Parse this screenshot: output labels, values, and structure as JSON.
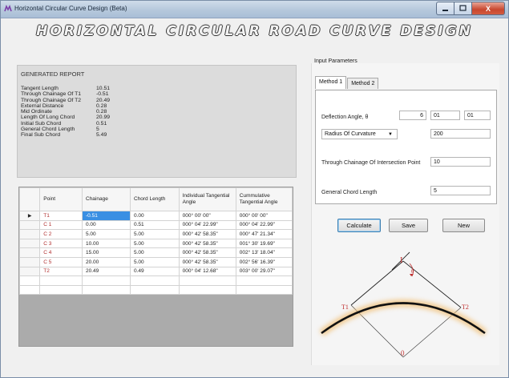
{
  "window": {
    "title": "Horizontal Circular Curve Design (Beta)",
    "min_label": "",
    "max_label": "",
    "close_label": "X"
  },
  "banner": "HORIZONTAL CIRCULAR ROAD CURVE DESIGN",
  "report": {
    "title": "GENERATED REPORT",
    "labels": [
      "Tangent Length",
      "Through Chainage Of T1",
      "Through Chainage Of T2",
      "External Distance",
      "Mid Ordinate",
      "Length Of Long Chord",
      "Initial Sub Chord",
      "General Chord Length",
      "Final Sub Chord"
    ],
    "values": [
      "10.51",
      "-0.51",
      "20.49",
      "0.28",
      "0.28",
      "20.99",
      "0.51",
      "5",
      "5.49"
    ]
  },
  "grid": {
    "columns": [
      "Point",
      "Chainage",
      "Chord Length",
      "Individual Tangential Angle",
      "Cummulative Tangential Angle"
    ],
    "current_row_marker": "▶",
    "rows": [
      [
        "T1",
        "-0.51",
        "0.00",
        "000° 00' 00\"",
        "000° 00' 00\""
      ],
      [
        "C 1",
        "0.00",
        "0.51",
        "000° 04' 22.99\"",
        "000° 04' 22.99\""
      ],
      [
        "C 2",
        "5.00",
        "5.00",
        "000° 42' 58.35\"",
        "000° 47' 21.34\""
      ],
      [
        "C 3",
        "10.00",
        "5.00",
        "000° 42' 58.35\"",
        "001° 30' 19.69\""
      ],
      [
        "C 4",
        "15.00",
        "5.00",
        "000° 42' 58.35\"",
        "002° 13' 18.04\""
      ],
      [
        "C 5",
        "20.00",
        "5.00",
        "000° 42' 58.35\"",
        "002° 56' 16.39\""
      ],
      [
        "T2",
        "20.49",
        "0.49",
        "000° 04' 12.68\"",
        "003° 00' 29.07\""
      ]
    ]
  },
  "params": {
    "title": "Input Parameters",
    "tabs": [
      "Method 1",
      "Method 2"
    ],
    "deflection_label": "Deflection Angle, θ",
    "deflection_deg": "6",
    "deflection_min": "01",
    "deflection_sec": "01",
    "radius_select": "Radius Of Curvature",
    "radius_value": "200",
    "chainage_label": "Through Chainage Of Intersection Point",
    "chainage_value": "10",
    "chord_label": "General Chord Length",
    "chord_value": "5"
  },
  "buttons": {
    "calculate": "Calculate",
    "save": "Save",
    "new": "New"
  },
  "diagram": {
    "label_i": "I",
    "label_theta": "θ",
    "label_t1": "T1",
    "label_t2": "T2",
    "label_o": "0"
  },
  "colors": {
    "selection": "#3a8fe3",
    "point_text": "#b02d2d",
    "curve_glow": "#f1c27d"
  },
  "icons": {
    "app": "app-icon",
    "row_marker": "row-pointer-icon",
    "combo": "dropdown-arrow-icon"
  }
}
